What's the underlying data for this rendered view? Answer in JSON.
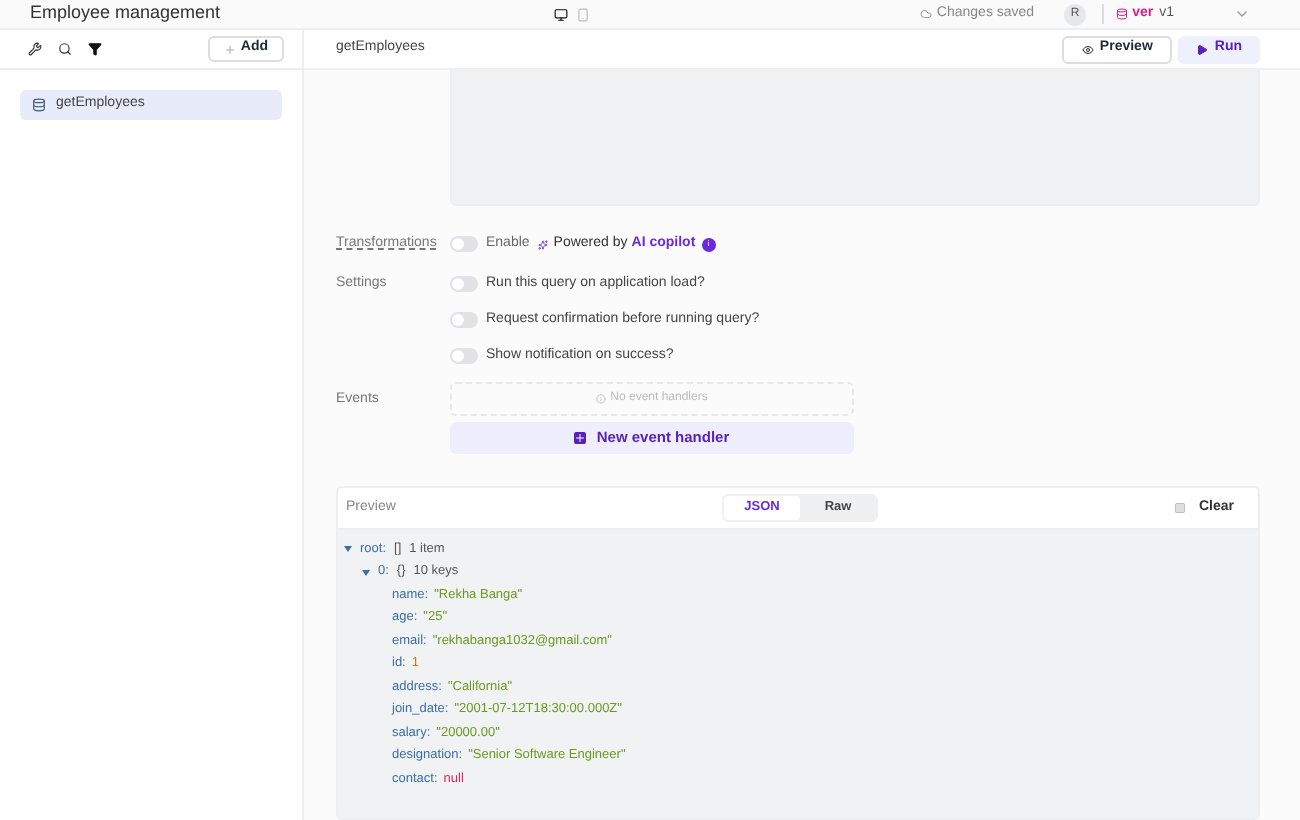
{
  "app_title": "Employee management",
  "status": "Changes saved",
  "avatar": "R",
  "version": {
    "label": "ver",
    "value": "v1"
  },
  "sidebar": {
    "add_button": "Add",
    "items": [
      {
        "label": "getEmployees",
        "selected": true
      }
    ]
  },
  "query": {
    "name": "getEmployees",
    "preview_button": "Preview",
    "run_button": "Run"
  },
  "transformations": {
    "label": "Transformations",
    "on": false,
    "toggle_label": "Enable",
    "powered_by": "Powered by",
    "copilot": "AI copilot",
    "badge": "i"
  },
  "settings": {
    "label": "Settings",
    "options": [
      {
        "label": "Run this query on application load?",
        "on": false
      },
      {
        "label": "Request confirmation before running query?",
        "on": false
      },
      {
        "label": "Show notification on success?",
        "on": false
      }
    ]
  },
  "events": {
    "label": "Events",
    "empty": "No event handlers",
    "new_button": "New event handler"
  },
  "preview": {
    "title": "Preview",
    "tabs": [
      {
        "label": "JSON",
        "selected": true
      },
      {
        "label": "Raw",
        "selected": false
      }
    ],
    "clear": "Clear",
    "root": {
      "key": "root:",
      "type": "[]",
      "summary": "1 item",
      "expanded": true
    },
    "item": {
      "key": "0:",
      "type": "{}",
      "summary": "10 keys",
      "expanded": true
    },
    "fields": [
      {
        "key": "name:",
        "value": "\"Rekha Banga\"",
        "kind": "string"
      },
      {
        "key": "age:",
        "value": "\"25\"",
        "kind": "string"
      },
      {
        "key": "email:",
        "value": "\"rekhabanga1032@gmail.com\"",
        "kind": "string"
      },
      {
        "key": "id:",
        "value": "1",
        "kind": "number"
      },
      {
        "key": "address:",
        "value": "\"California\"",
        "kind": "string"
      },
      {
        "key": "join_date:",
        "value": "\"2001-07-12T18:30:00.000Z\"",
        "kind": "string"
      },
      {
        "key": "salary:",
        "value": "\"20000.00\"",
        "kind": "string"
      },
      {
        "key": "designation:",
        "value": "\"Senior Software Engineer\"",
        "kind": "string"
      },
      {
        "key": "contact:",
        "value": "null",
        "kind": "null"
      }
    ]
  }
}
